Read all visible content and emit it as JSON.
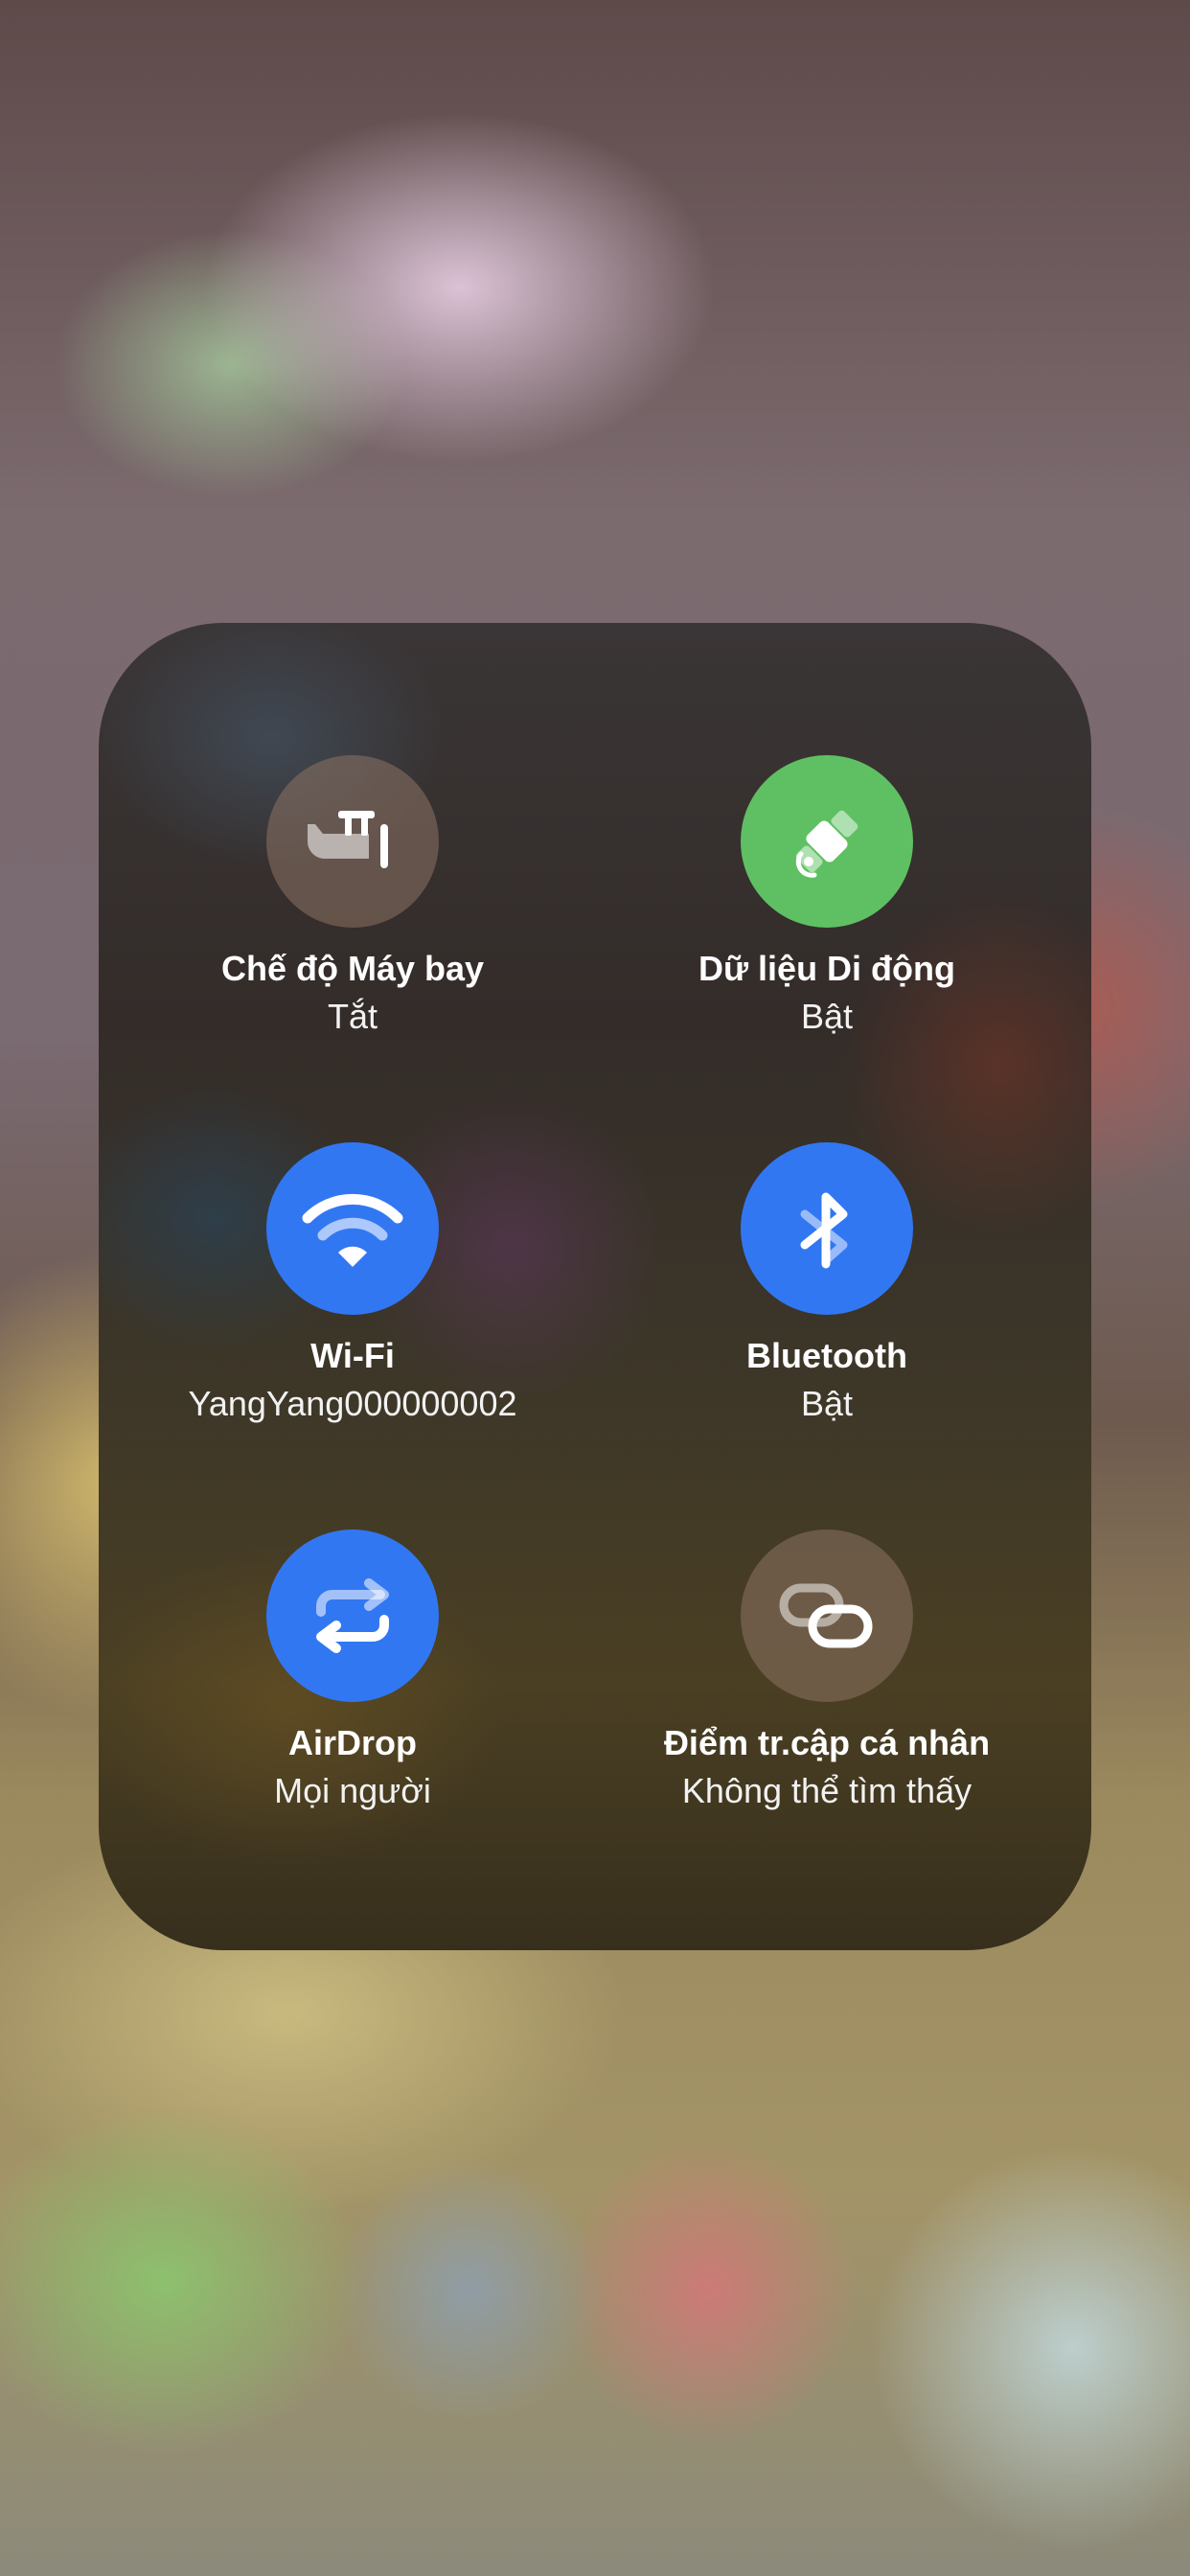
{
  "colors": {
    "off": "#8c7364",
    "green": "#5ec062",
    "blue": "#3277f2"
  },
  "tiles": [
    {
      "title": "Chế độ Máy bay",
      "status": "Tắt",
      "icon": "airplane-icon",
      "state": "off"
    },
    {
      "title": "Dữ liệu Di động",
      "status": "Bật",
      "icon": "cellular-data-icon",
      "state": "on"
    },
    {
      "title": "Wi-Fi",
      "status": "YangYang000000002",
      "icon": "wifi-icon",
      "state": "on"
    },
    {
      "title": "Bluetooth",
      "status": "Bật",
      "icon": "bluetooth-icon",
      "state": "on"
    },
    {
      "title": "AirDrop",
      "status": "Mọi người",
      "icon": "airdrop-icon",
      "state": "on"
    },
    {
      "title": "Điểm tr.cập cá nhân",
      "status": "Không thể tìm thấy",
      "icon": "personal-hotspot-icon",
      "state": "off"
    }
  ]
}
